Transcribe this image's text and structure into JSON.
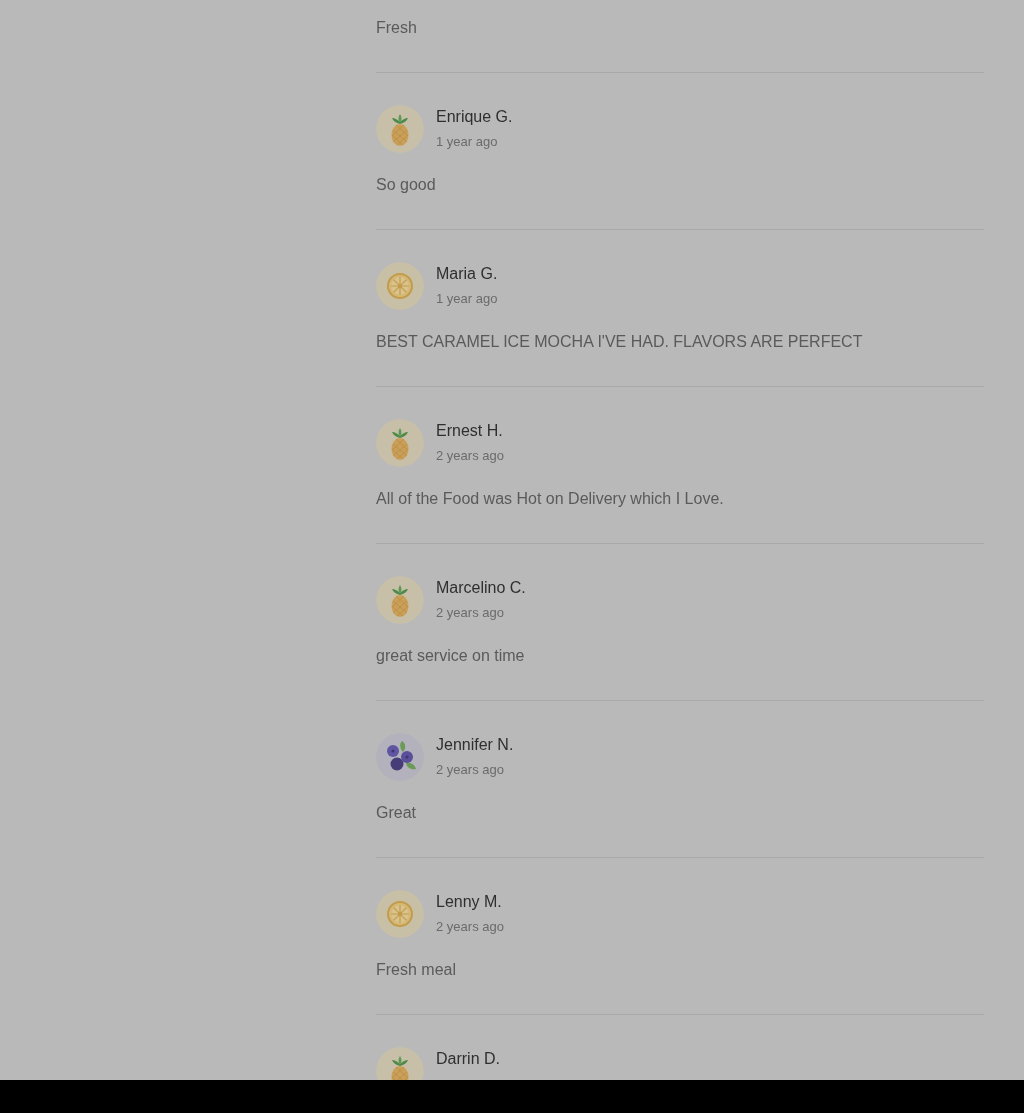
{
  "reviews": [
    {
      "comment": "Fresh"
    },
    {
      "kind": "pineapple",
      "name": "Enrique G.",
      "date": "1 year ago",
      "comment": "So good"
    },
    {
      "kind": "citrus",
      "name": "Maria G.",
      "date": "1 year ago",
      "comment": "BEST CARAMEL ICE MOCHA I'VE HAD. FLAVORS ARE PERFECT"
    },
    {
      "kind": "pineapple",
      "name": "Ernest H.",
      "date": "2 years ago",
      "comment": "All of the Food was Hot on Delivery which I Love."
    },
    {
      "kind": "pineapple",
      "name": "Marcelino C.",
      "date": "2 years ago",
      "comment": "great service on time"
    },
    {
      "kind": "berries",
      "name": "Jennifer N.",
      "date": "2 years ago",
      "comment": "Great"
    },
    {
      "kind": "citrus",
      "name": "Lenny M.",
      "date": "2 years ago",
      "comment": "Fresh meal"
    },
    {
      "kind": "pineapple",
      "name": "Darrin D."
    }
  ]
}
